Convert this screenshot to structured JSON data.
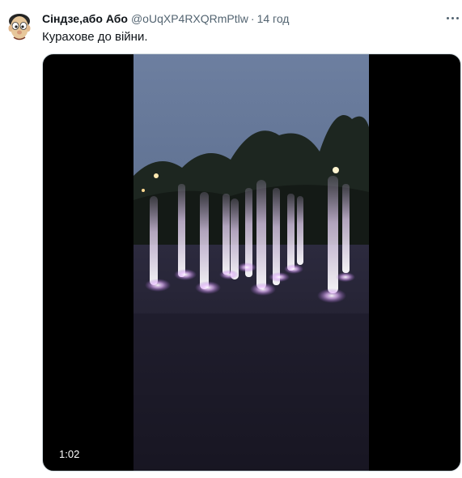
{
  "tweet": {
    "author_name": "Сіндзе,або Або",
    "handle": "@oUqXP4RXQRmPtlw",
    "separator": "·",
    "time": "14 год",
    "text": "Курахове до війни.",
    "avatar_icon": "cartoon-face-avatar-icon",
    "more_icon": "more-options-icon"
  },
  "video": {
    "duration": "1:02",
    "scene": "fountain-at-dusk-thumbnail"
  },
  "colors": {
    "handle_gray": "#536471",
    "video_background": "#000000",
    "sky": "#5a6c8c",
    "fountain_glow": "#e8b8ff"
  }
}
